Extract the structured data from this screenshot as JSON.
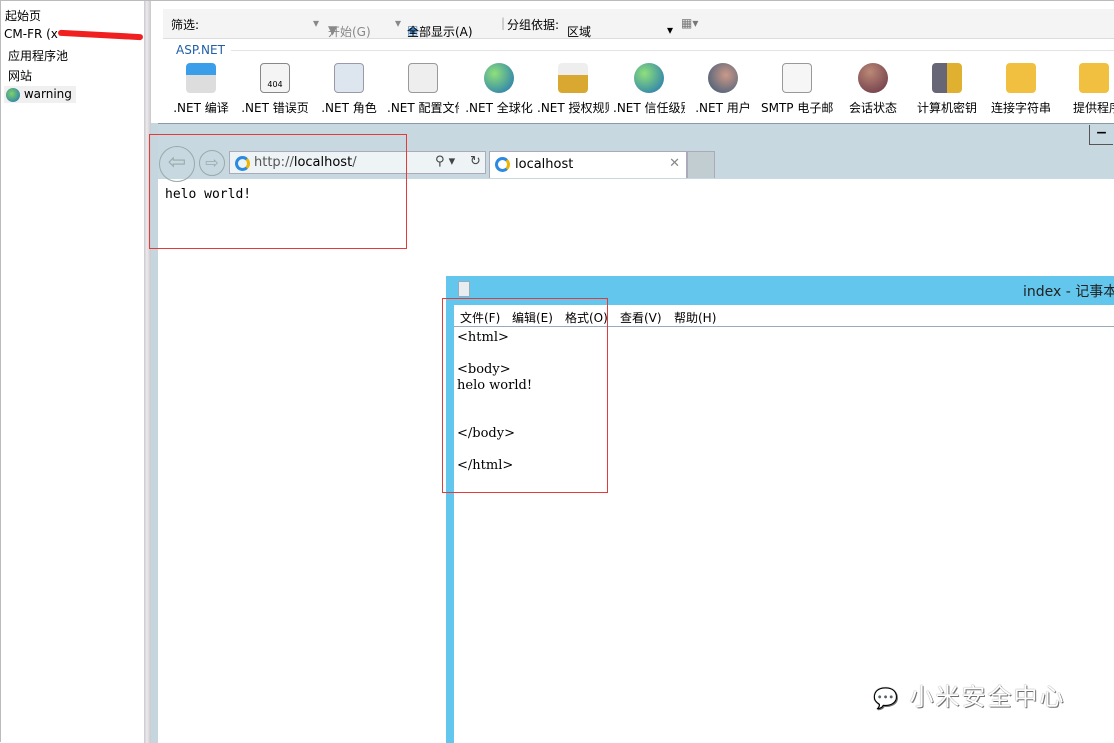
{
  "tree": {
    "items": [
      "起始页",
      "CM-FR (x",
      "应用程序池",
      "网站",
      "warning"
    ]
  },
  "filter": {
    "label": "筛选:",
    "start": "开始(G)",
    "show_all": "全部显示(A)",
    "group_by": "分组依据:",
    "group_value": "区域"
  },
  "section": "ASP.NET",
  "features": [
    ".NET 编译",
    ".NET 错误页",
    ".NET 角色",
    ".NET 配置文件",
    ".NET 全球化",
    ".NET 授权规则",
    ".NET 信任级别",
    ".NET 用户",
    "SMTP 电子邮件",
    "会话状态",
    "计算机密钥",
    "连接字符串",
    "提供程序"
  ],
  "browser": {
    "url_prefix": "http://",
    "url_host": "localhost",
    "url_suffix": "/",
    "tab_title": "localhost",
    "content": "helo world!",
    "minimize": "−"
  },
  "notepad": {
    "title": "index - 记事本",
    "menu": [
      "文件(F)",
      "编辑(E)",
      "格式(O)",
      "查看(V)",
      "帮助(H)"
    ],
    "text": "<html>\n\n<body>\nhelo world!\n\n\n</body>\n\n</html>"
  },
  "watermark": "小米安全中心",
  "colors": {
    "notepad_title": "#63c6ec",
    "highlight_box": "#e03c3c",
    "ie_frame": "#c8d8e0"
  }
}
